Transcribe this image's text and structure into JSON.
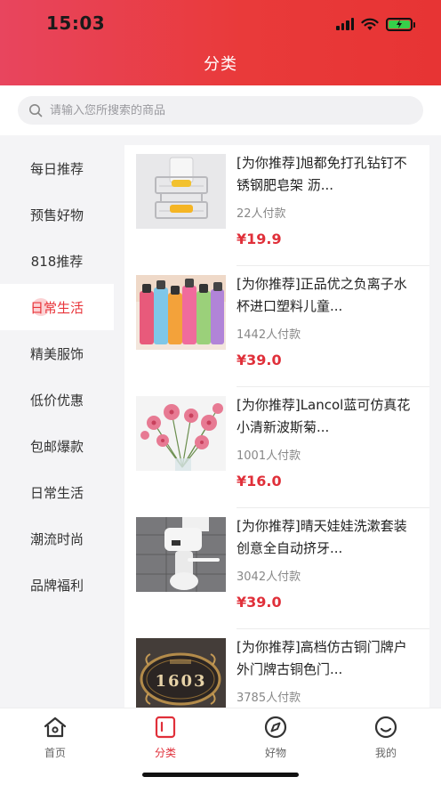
{
  "status": {
    "time": "15:03"
  },
  "header": {
    "title": "分类"
  },
  "search": {
    "placeholder": "请输入您所搜索的商品"
  },
  "sidebar": {
    "items": [
      {
        "label": "每日推荐",
        "active": false
      },
      {
        "label": "预售好物",
        "active": false
      },
      {
        "label": "818推荐",
        "active": false
      },
      {
        "label": "日常生活",
        "active": true
      },
      {
        "label": "精美服饰",
        "active": false
      },
      {
        "label": "低价优惠",
        "active": false
      },
      {
        "label": "包邮爆款",
        "active": false
      },
      {
        "label": "日常生活",
        "active": false
      },
      {
        "label": "潮流时尚",
        "active": false
      },
      {
        "label": "品牌福利",
        "active": false
      }
    ]
  },
  "products": [
    {
      "title": "[为你推荐]旭都免打孔钻钉不锈钢肥皂架 沥...",
      "sold": "22人付款",
      "price": "¥19.9"
    },
    {
      "title": "[为你推荐]正品优之负离子水杯进口塑料儿童...",
      "sold": "1442人付款",
      "price": "¥39.0"
    },
    {
      "title": "[为你推荐]Lancol蓝可仿真花小清新波斯菊...",
      "sold": "1001人付款",
      "price": "¥16.0"
    },
    {
      "title": "[为你推荐]晴天娃娃洗漱套装创意全自动挤牙...",
      "sold": "3042人付款",
      "price": "¥39.0"
    },
    {
      "title": "[为你推荐]高档仿古铜门牌户外门牌古铜色门...",
      "sold": "3785人付款",
      "price": ""
    }
  ],
  "doorplate_text": "1603",
  "tabbar": {
    "items": [
      {
        "label": "首页",
        "icon": "home-icon",
        "active": false
      },
      {
        "label": "分类",
        "icon": "category-icon",
        "active": true
      },
      {
        "label": "好物",
        "icon": "compass-icon",
        "active": false
      },
      {
        "label": "我的",
        "icon": "smile-icon",
        "active": false
      }
    ]
  },
  "colors": {
    "accent": "#e0303a",
    "header_start": "#e8455e",
    "header_end": "#e73434"
  }
}
